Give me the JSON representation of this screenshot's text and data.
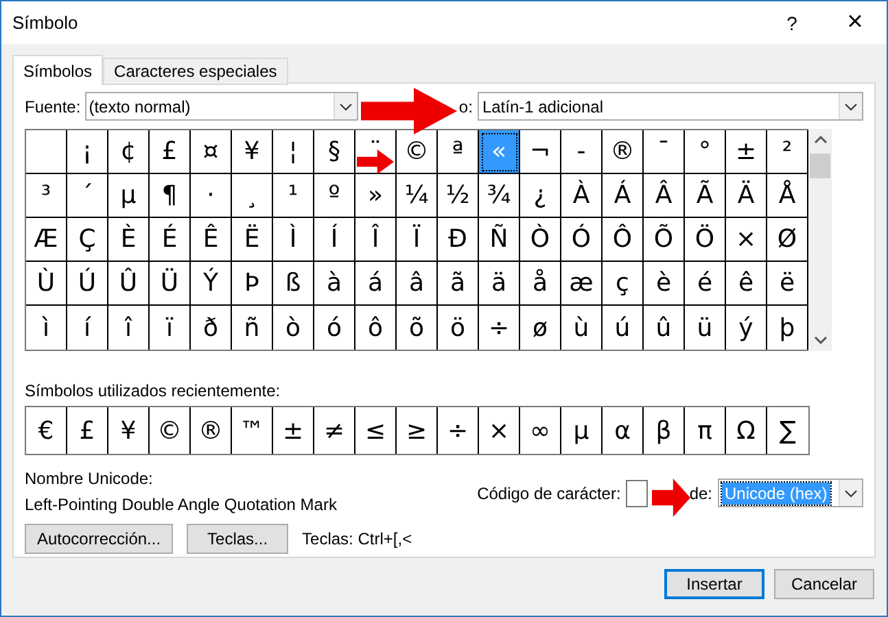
{
  "window": {
    "title": "Símbolo",
    "help": "?",
    "close": "×"
  },
  "tabs": [
    {
      "label": "Símbolos",
      "selected": true
    },
    {
      "label": "Caracteres especiales",
      "selected": false
    }
  ],
  "font": {
    "label": "Fuente:",
    "value": "(texto normal)"
  },
  "subset": {
    "label": "o:",
    "value": "Latín-1 adicional"
  },
  "symbol_grid": [
    [
      {
        "selected": false
      },
      {
        "char": "¡",
        "selected": false
      },
      {
        "char": "¢",
        "selected": false
      },
      {
        "char": "£",
        "selected": false
      },
      {
        "char": "¤",
        "selected": false
      },
      {
        "char": "¥",
        "selected": false
      },
      {
        "char": "¦",
        "selected": false
      },
      {
        "char": "§",
        "selected": false
      },
      {
        "char": "¨",
        "selected": false
      },
      {
        "char": "©",
        "selected": false
      },
      {
        "char": "ª",
        "selected": false
      },
      {
        "char": "«",
        "selected": true
      },
      {
        "char": "¬",
        "selected": false
      },
      {
        "char": "-",
        "selected": false
      },
      {
        "char": "®",
        "selected": false
      },
      {
        "char": "¯",
        "selected": false
      },
      {
        "char": "°",
        "selected": false
      },
      {
        "char": "±",
        "selected": false
      },
      {
        "char": "²",
        "selected": false
      }
    ],
    [
      {
        "char": "³",
        "selected": false
      },
      {
        "char": "´",
        "selected": false
      },
      {
        "char": "µ",
        "selected": false
      },
      {
        "char": "¶",
        "selected": false
      },
      {
        "char": "·",
        "selected": false
      },
      {
        "char": "¸",
        "selected": false
      },
      {
        "char": "¹",
        "selected": false
      },
      {
        "char": "º",
        "selected": false
      },
      {
        "char": "»",
        "selected": false
      },
      {
        "char": "¼",
        "selected": false
      },
      {
        "char": "½",
        "selected": false
      },
      {
        "char": "¾",
        "selected": false
      },
      {
        "char": "¿",
        "selected": false
      },
      {
        "char": "À",
        "selected": false
      },
      {
        "char": "Á",
        "selected": false
      },
      {
        "char": "Â",
        "selected": false
      },
      {
        "char": "Ã",
        "selected": false
      },
      {
        "char": "Ä",
        "selected": false
      },
      {
        "char": "Å",
        "selected": false
      }
    ],
    [
      {
        "char": "Æ",
        "selected": false
      },
      {
        "char": "Ç",
        "selected": false
      },
      {
        "char": "È",
        "selected": false
      },
      {
        "char": "É",
        "selected": false
      },
      {
        "char": "Ê",
        "selected": false
      },
      {
        "char": "Ë",
        "selected": false
      },
      {
        "char": "Ì",
        "selected": false
      },
      {
        "char": "Í",
        "selected": false
      },
      {
        "char": "Î",
        "selected": false
      },
      {
        "char": "Ï",
        "selected": false
      },
      {
        "char": "Ð",
        "selected": false
      },
      {
        "char": "Ñ",
        "selected": false
      },
      {
        "char": "Ò",
        "selected": false
      },
      {
        "char": "Ó",
        "selected": false
      },
      {
        "char": "Ô",
        "selected": false
      },
      {
        "char": "Õ",
        "selected": false
      },
      {
        "char": "Ö",
        "selected": false
      },
      {
        "char": "×",
        "selected": false
      },
      {
        "char": "Ø",
        "selected": false
      }
    ],
    [
      {
        "char": "Ù",
        "selected": false
      },
      {
        "char": "Ú",
        "selected": false
      },
      {
        "char": "Û",
        "selected": false
      },
      {
        "char": "Ü",
        "selected": false
      },
      {
        "char": "Ý",
        "selected": false
      },
      {
        "char": "Þ",
        "selected": false
      },
      {
        "char": "ß",
        "selected": false
      },
      {
        "char": "à",
        "selected": false
      },
      {
        "char": "á",
        "selected": false
      },
      {
        "char": "â",
        "selected": false
      },
      {
        "char": "ã",
        "selected": false
      },
      {
        "char": "ä",
        "selected": false
      },
      {
        "char": "å",
        "selected": false
      },
      {
        "char": "æ",
        "selected": false
      },
      {
        "char": "ç",
        "selected": false
      },
      {
        "char": "è",
        "selected": false
      },
      {
        "char": "é",
        "selected": false
      },
      {
        "char": "ê",
        "selected": false
      },
      {
        "char": "ë",
        "selected": false
      }
    ],
    [
      {
        "char": "ì",
        "selected": false
      },
      {
        "char": "í",
        "selected": false
      },
      {
        "char": "î",
        "selected": false
      },
      {
        "char": "ï",
        "selected": false
      },
      {
        "char": "ð",
        "selected": false
      },
      {
        "char": "ñ",
        "selected": false
      },
      {
        "char": "ò",
        "selected": false
      },
      {
        "char": "ó",
        "selected": false
      },
      {
        "char": "ô",
        "selected": false
      },
      {
        "char": "õ",
        "selected": false
      },
      {
        "char": "ö",
        "selected": false
      },
      {
        "char": "÷",
        "selected": false
      },
      {
        "char": "ø",
        "selected": false
      },
      {
        "char": "ù",
        "selected": false
      },
      {
        "char": "ú",
        "selected": false
      },
      {
        "char": "û",
        "selected": false
      },
      {
        "char": "ü",
        "selected": false
      },
      {
        "char": "ý",
        "selected": false
      },
      {
        "char": "þ",
        "selected": false
      }
    ]
  ],
  "recent": {
    "label": "Símbolos utilizados recientemente:",
    "symbols": [
      "€",
      "£",
      "¥",
      "©",
      "®",
      "™",
      "±",
      "≠",
      "≤",
      "≥",
      "÷",
      "×",
      "∞",
      "µ",
      "α",
      "β",
      "π",
      "Ω",
      "∑"
    ]
  },
  "unicode_name": {
    "label": "Nombre Unicode:",
    "value": "Left-Pointing Double Angle Quotation Mark"
  },
  "character_code": {
    "label": "Código de carácter:",
    "from_label": "de:",
    "from_value": "Unicode (hex)"
  },
  "buttons": [
    {
      "label": "Autocorrección..."
    },
    {
      "label": "Teclas..."
    }
  ],
  "shortcut": "Teclas: Ctrl+[,<",
  "footer_buttons": [
    {
      "label": "Insertar",
      "default": true
    },
    {
      "label": "Cancelar",
      "default": false
    }
  ],
  "annotations": [
    {
      "kind": "arrow"
    },
    {
      "kind": "arrow"
    },
    {
      "kind": "arrow"
    }
  ]
}
